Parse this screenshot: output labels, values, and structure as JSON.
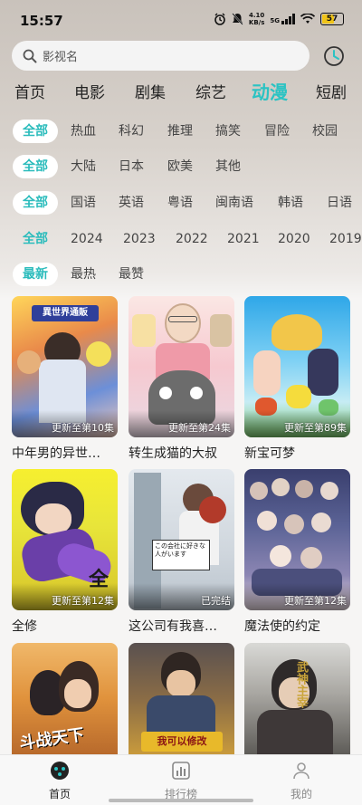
{
  "status_bar": {
    "time": "15:57",
    "net_speed": "4.10",
    "net_unit": "KB/s",
    "signal": "5G",
    "battery": "57"
  },
  "search": {
    "placeholder": "影视名"
  },
  "category_tabs": [
    "首页",
    "电影",
    "剧集",
    "综艺",
    "动漫",
    "短剧"
  ],
  "active_category": "动漫",
  "filters": {
    "genre": [
      "全部",
      "热血",
      "科幻",
      "推理",
      "搞笑",
      "冒险",
      "校园"
    ],
    "region": [
      "全部",
      "大陆",
      "日本",
      "欧美",
      "其他"
    ],
    "language": [
      "全部",
      "国语",
      "英语",
      "粤语",
      "闽南语",
      "韩语",
      "日语"
    ],
    "year": [
      "全部",
      "2024",
      "2023",
      "2022",
      "2021",
      "2020",
      "2019"
    ],
    "sort": [
      "最新",
      "最热",
      "最赞"
    ]
  },
  "items": [
    {
      "title": "中年男的异世…",
      "badge": "更新至第10集",
      "poster_text": "異世界通販"
    },
    {
      "title": "转生成猫的大叔",
      "badge": "更新至第24集",
      "poster_text": ""
    },
    {
      "title": "新宝可梦",
      "badge": "更新至第89集",
      "poster_text": ""
    },
    {
      "title": "全修",
      "badge": "更新至第12集",
      "poster_text": "全"
    },
    {
      "title": "这公司有我喜…",
      "badge": "已完结",
      "poster_text": "この会社に好きな人がいます"
    },
    {
      "title": "魔法使的约定",
      "badge": "更新至第12集",
      "poster_text": ""
    },
    {
      "title": "",
      "badge": "",
      "poster_text": "斗战天下"
    },
    {
      "title": "",
      "badge": "",
      "poster_text": "我可以修改"
    },
    {
      "title": "",
      "badge": "",
      "poster_text": "武神主宰"
    }
  ],
  "bottom_nav": [
    "首页",
    "排行榜",
    "我的"
  ],
  "colors": {
    "accent": "#2bc3c3",
    "background": "#f6f5f4"
  }
}
